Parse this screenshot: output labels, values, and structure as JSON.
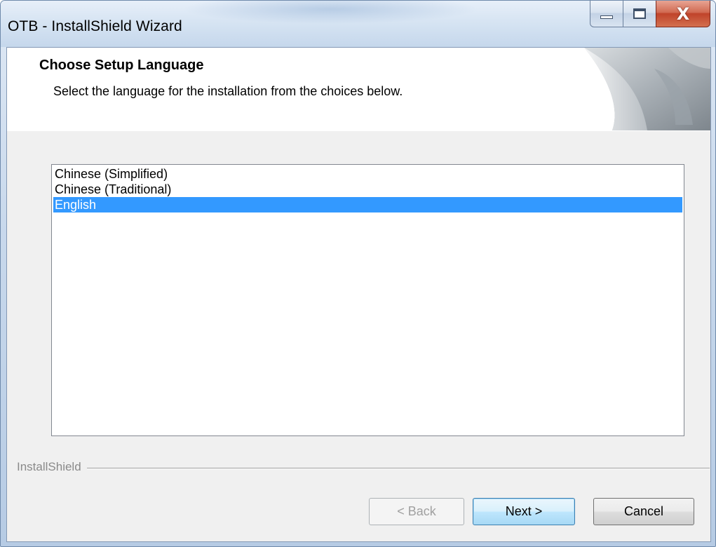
{
  "window": {
    "title": "OTB - InstallShield Wizard",
    "caption_buttons": {
      "minimize": "minimize-icon",
      "maximize": "maximize-icon",
      "close_glyph": "X"
    }
  },
  "header": {
    "title": "Choose Setup Language",
    "subtitle": "Select the language for the installation from the choices below."
  },
  "language_list": {
    "items": [
      {
        "label": "Chinese (Simplified)",
        "selected": false
      },
      {
        "label": "Chinese (Traditional)",
        "selected": false
      },
      {
        "label": "English",
        "selected": true
      }
    ]
  },
  "branding": {
    "label": "InstallShield"
  },
  "buttons": {
    "back": {
      "label": "< Back",
      "enabled": false
    },
    "next": {
      "label": "Next >",
      "enabled": true,
      "default": true
    },
    "cancel": {
      "label": "Cancel",
      "enabled": true
    }
  },
  "colors": {
    "selection": "#3399ff",
    "selection_text": "#ffffff",
    "dialog_face": "#f0f0f0",
    "header_background": "#ffffff",
    "close_button": "#c0432a"
  }
}
